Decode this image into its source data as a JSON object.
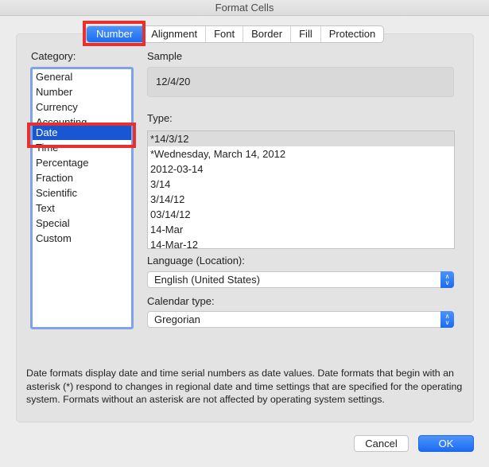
{
  "window": {
    "title": "Format Cells"
  },
  "tabs": [
    {
      "label": "Number",
      "active": true
    },
    {
      "label": "Alignment",
      "active": false
    },
    {
      "label": "Font",
      "active": false
    },
    {
      "label": "Border",
      "active": false
    },
    {
      "label": "Fill",
      "active": false
    },
    {
      "label": "Protection",
      "active": false
    }
  ],
  "category": {
    "label": "Category:",
    "items": [
      "General",
      "Number",
      "Currency",
      "Accounting",
      "Date",
      "Time",
      "Percentage",
      "Fraction",
      "Scientific",
      "Text",
      "Special",
      "Custom"
    ],
    "selected": "Date"
  },
  "sample": {
    "label": "Sample",
    "value": "12/4/20"
  },
  "type": {
    "label": "Type:",
    "items": [
      "*14/3/12",
      "*Wednesday, March 14, 2012",
      "2012-03-14",
      "3/14",
      "3/14/12",
      "03/14/12",
      "14-Mar",
      "14-Mar-12"
    ],
    "selected": "*14/3/12"
  },
  "language": {
    "label": "Language (Location):",
    "value": "English (United States)"
  },
  "calendar": {
    "label": "Calendar type:",
    "value": "Gregorian"
  },
  "description": "Date formats display date and time serial numbers as date values.  Date formats that begin with an asterisk (*) respond to changes in regional date and time settings that are specified for the operating system. Formats without an asterisk are not affected by operating system settings.",
  "buttons": {
    "cancel": "Cancel",
    "ok": "OK"
  },
  "colors": {
    "accent": "#1b6cf2",
    "selection": "#1856d4",
    "highlight_box": "#e8302c"
  }
}
